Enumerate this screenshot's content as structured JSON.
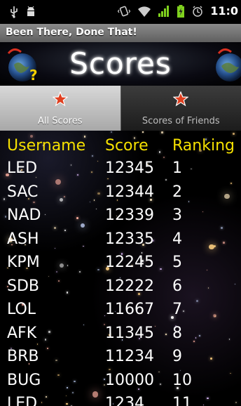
{
  "status_bar": {
    "icons": [
      "usb-icon",
      "android-debug-icon",
      "vibrate-icon",
      "wifi-icon",
      "signal-icon",
      "battery-icon",
      "alarm-icon"
    ],
    "time": "11:0"
  },
  "app": {
    "title": "Been There, Done That!"
  },
  "header": {
    "title": "Scores"
  },
  "tabs": [
    {
      "label": "All Scores",
      "active": true
    },
    {
      "label": "Scores of Friends",
      "active": false
    }
  ],
  "table": {
    "headers": {
      "username": "Username",
      "score": "Score",
      "ranking": "Ranking"
    },
    "rows": [
      {
        "username": "LED",
        "score": "12345",
        "ranking": "1"
      },
      {
        "username": "SAC",
        "score": "12344",
        "ranking": "2"
      },
      {
        "username": "NAD",
        "score": "12339",
        "ranking": "3"
      },
      {
        "username": "ASH",
        "score": "12335",
        "ranking": "4"
      },
      {
        "username": "KPM",
        "score": "12245",
        "ranking": "5"
      },
      {
        "username": "SDB",
        "score": "12222",
        "ranking": "6"
      },
      {
        "username": "LOL",
        "score": "11667",
        "ranking": "7"
      },
      {
        "username": "AFK",
        "score": "11345",
        "ranking": "8"
      },
      {
        "username": "BRB",
        "score": "11234",
        "ranking": "9"
      },
      {
        "username": "BUG",
        "score": "10000",
        "ranking": "10"
      },
      {
        "username": "LED",
        "score": "1234",
        "ranking": "11"
      }
    ]
  },
  "colors": {
    "header_text": "#f5e000",
    "row_text": "#ffffff",
    "tab_star": "#e04020"
  }
}
